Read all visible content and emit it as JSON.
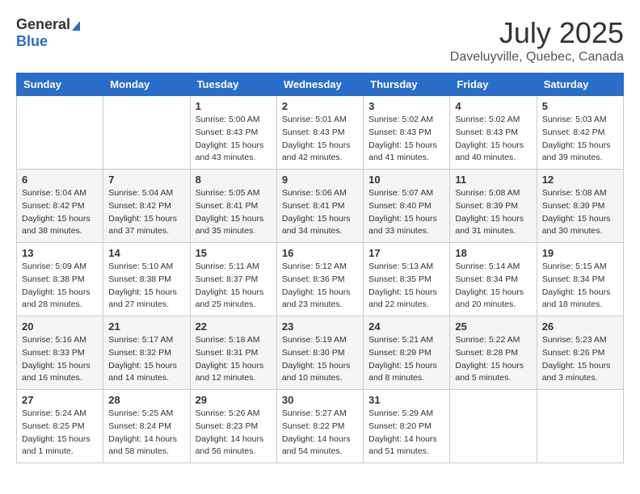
{
  "logo": {
    "general": "General",
    "blue": "Blue"
  },
  "title": "July 2025",
  "location": "Daveluyville, Quebec, Canada",
  "weekdays": [
    "Sunday",
    "Monday",
    "Tuesday",
    "Wednesday",
    "Thursday",
    "Friday",
    "Saturday"
  ],
  "weeks": [
    [
      {
        "day": "",
        "sunrise": "",
        "sunset": "",
        "daylight": ""
      },
      {
        "day": "",
        "sunrise": "",
        "sunset": "",
        "daylight": ""
      },
      {
        "day": "1",
        "sunrise": "Sunrise: 5:00 AM",
        "sunset": "Sunset: 8:43 PM",
        "daylight": "Daylight: 15 hours and 43 minutes."
      },
      {
        "day": "2",
        "sunrise": "Sunrise: 5:01 AM",
        "sunset": "Sunset: 8:43 PM",
        "daylight": "Daylight: 15 hours and 42 minutes."
      },
      {
        "day": "3",
        "sunrise": "Sunrise: 5:02 AM",
        "sunset": "Sunset: 8:43 PM",
        "daylight": "Daylight: 15 hours and 41 minutes."
      },
      {
        "day": "4",
        "sunrise": "Sunrise: 5:02 AM",
        "sunset": "Sunset: 8:43 PM",
        "daylight": "Daylight: 15 hours and 40 minutes."
      },
      {
        "day": "5",
        "sunrise": "Sunrise: 5:03 AM",
        "sunset": "Sunset: 8:42 PM",
        "daylight": "Daylight: 15 hours and 39 minutes."
      }
    ],
    [
      {
        "day": "6",
        "sunrise": "Sunrise: 5:04 AM",
        "sunset": "Sunset: 8:42 PM",
        "daylight": "Daylight: 15 hours and 38 minutes."
      },
      {
        "day": "7",
        "sunrise": "Sunrise: 5:04 AM",
        "sunset": "Sunset: 8:42 PM",
        "daylight": "Daylight: 15 hours and 37 minutes."
      },
      {
        "day": "8",
        "sunrise": "Sunrise: 5:05 AM",
        "sunset": "Sunset: 8:41 PM",
        "daylight": "Daylight: 15 hours and 35 minutes."
      },
      {
        "day": "9",
        "sunrise": "Sunrise: 5:06 AM",
        "sunset": "Sunset: 8:41 PM",
        "daylight": "Daylight: 15 hours and 34 minutes."
      },
      {
        "day": "10",
        "sunrise": "Sunrise: 5:07 AM",
        "sunset": "Sunset: 8:40 PM",
        "daylight": "Daylight: 15 hours and 33 minutes."
      },
      {
        "day": "11",
        "sunrise": "Sunrise: 5:08 AM",
        "sunset": "Sunset: 8:39 PM",
        "daylight": "Daylight: 15 hours and 31 minutes."
      },
      {
        "day": "12",
        "sunrise": "Sunrise: 5:08 AM",
        "sunset": "Sunset: 8:39 PM",
        "daylight": "Daylight: 15 hours and 30 minutes."
      }
    ],
    [
      {
        "day": "13",
        "sunrise": "Sunrise: 5:09 AM",
        "sunset": "Sunset: 8:38 PM",
        "daylight": "Daylight: 15 hours and 28 minutes."
      },
      {
        "day": "14",
        "sunrise": "Sunrise: 5:10 AM",
        "sunset": "Sunset: 8:38 PM",
        "daylight": "Daylight: 15 hours and 27 minutes."
      },
      {
        "day": "15",
        "sunrise": "Sunrise: 5:11 AM",
        "sunset": "Sunset: 8:37 PM",
        "daylight": "Daylight: 15 hours and 25 minutes."
      },
      {
        "day": "16",
        "sunrise": "Sunrise: 5:12 AM",
        "sunset": "Sunset: 8:36 PM",
        "daylight": "Daylight: 15 hours and 23 minutes."
      },
      {
        "day": "17",
        "sunrise": "Sunrise: 5:13 AM",
        "sunset": "Sunset: 8:35 PM",
        "daylight": "Daylight: 15 hours and 22 minutes."
      },
      {
        "day": "18",
        "sunrise": "Sunrise: 5:14 AM",
        "sunset": "Sunset: 8:34 PM",
        "daylight": "Daylight: 15 hours and 20 minutes."
      },
      {
        "day": "19",
        "sunrise": "Sunrise: 5:15 AM",
        "sunset": "Sunset: 8:34 PM",
        "daylight": "Daylight: 15 hours and 18 minutes."
      }
    ],
    [
      {
        "day": "20",
        "sunrise": "Sunrise: 5:16 AM",
        "sunset": "Sunset: 8:33 PM",
        "daylight": "Daylight: 15 hours and 16 minutes."
      },
      {
        "day": "21",
        "sunrise": "Sunrise: 5:17 AM",
        "sunset": "Sunset: 8:32 PM",
        "daylight": "Daylight: 15 hours and 14 minutes."
      },
      {
        "day": "22",
        "sunrise": "Sunrise: 5:18 AM",
        "sunset": "Sunset: 8:31 PM",
        "daylight": "Daylight: 15 hours and 12 minutes."
      },
      {
        "day": "23",
        "sunrise": "Sunrise: 5:19 AM",
        "sunset": "Sunset: 8:30 PM",
        "daylight": "Daylight: 15 hours and 10 minutes."
      },
      {
        "day": "24",
        "sunrise": "Sunrise: 5:21 AM",
        "sunset": "Sunset: 8:29 PM",
        "daylight": "Daylight: 15 hours and 8 minutes."
      },
      {
        "day": "25",
        "sunrise": "Sunrise: 5:22 AM",
        "sunset": "Sunset: 8:28 PM",
        "daylight": "Daylight: 15 hours and 5 minutes."
      },
      {
        "day": "26",
        "sunrise": "Sunrise: 5:23 AM",
        "sunset": "Sunset: 8:26 PM",
        "daylight": "Daylight: 15 hours and 3 minutes."
      }
    ],
    [
      {
        "day": "27",
        "sunrise": "Sunrise: 5:24 AM",
        "sunset": "Sunset: 8:25 PM",
        "daylight": "Daylight: 15 hours and 1 minute."
      },
      {
        "day": "28",
        "sunrise": "Sunrise: 5:25 AM",
        "sunset": "Sunset: 8:24 PM",
        "daylight": "Daylight: 14 hours and 58 minutes."
      },
      {
        "day": "29",
        "sunrise": "Sunrise: 5:26 AM",
        "sunset": "Sunset: 8:23 PM",
        "daylight": "Daylight: 14 hours and 56 minutes."
      },
      {
        "day": "30",
        "sunrise": "Sunrise: 5:27 AM",
        "sunset": "Sunset: 8:22 PM",
        "daylight": "Daylight: 14 hours and 54 minutes."
      },
      {
        "day": "31",
        "sunrise": "Sunrise: 5:29 AM",
        "sunset": "Sunset: 8:20 PM",
        "daylight": "Daylight: 14 hours and 51 minutes."
      },
      {
        "day": "",
        "sunrise": "",
        "sunset": "",
        "daylight": ""
      },
      {
        "day": "",
        "sunrise": "",
        "sunset": "",
        "daylight": ""
      }
    ]
  ]
}
